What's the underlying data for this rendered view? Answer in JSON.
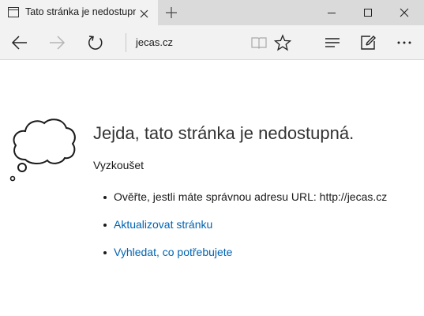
{
  "tab": {
    "title": "Tato stránka je nedostupná",
    "icon": "page-icon"
  },
  "address_bar": {
    "url": "jecas.cz"
  },
  "error_page": {
    "heading": "Jejda, tato stránka je nedostupná.",
    "subheading": "Vyzkoušet",
    "suggestions": [
      {
        "text": "Ověřte, jestli máte správnou adresu URL: http://jecas.cz",
        "link": false
      },
      {
        "text": "Aktualizovat stránku",
        "link": true
      },
      {
        "text": "Vyhledat, co potřebujete",
        "link": true
      }
    ]
  },
  "colors": {
    "link": "#0063b1",
    "tabbar_bg": "#dadada",
    "toolbar_bg": "#f2f2f2"
  }
}
